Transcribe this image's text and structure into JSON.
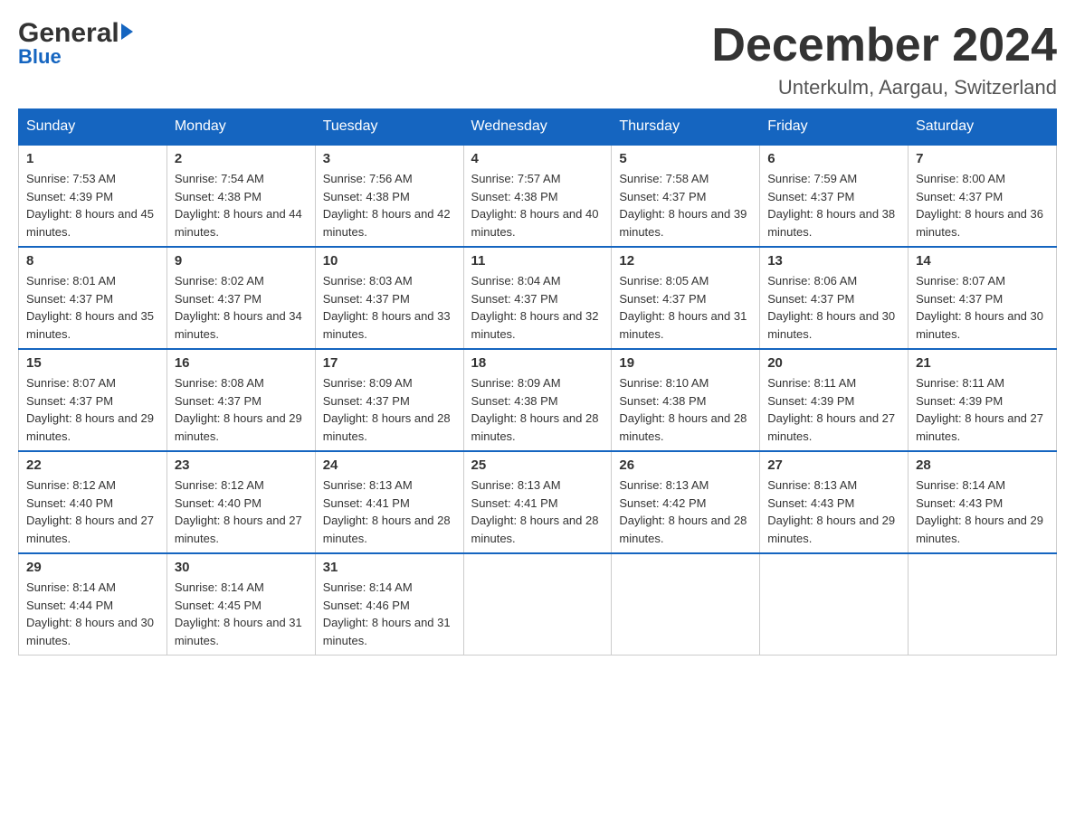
{
  "header": {
    "logo_general": "General",
    "logo_blue": "Blue",
    "month_title": "December 2024",
    "location": "Unterkulm, Aargau, Switzerland"
  },
  "weekdays": [
    "Sunday",
    "Monday",
    "Tuesday",
    "Wednesday",
    "Thursday",
    "Friday",
    "Saturday"
  ],
  "weeks": [
    [
      {
        "day": "1",
        "sunrise": "7:53 AM",
        "sunset": "4:39 PM",
        "daylight": "8 hours and 45 minutes."
      },
      {
        "day": "2",
        "sunrise": "7:54 AM",
        "sunset": "4:38 PM",
        "daylight": "8 hours and 44 minutes."
      },
      {
        "day": "3",
        "sunrise": "7:56 AM",
        "sunset": "4:38 PM",
        "daylight": "8 hours and 42 minutes."
      },
      {
        "day": "4",
        "sunrise": "7:57 AM",
        "sunset": "4:38 PM",
        "daylight": "8 hours and 40 minutes."
      },
      {
        "day": "5",
        "sunrise": "7:58 AM",
        "sunset": "4:37 PM",
        "daylight": "8 hours and 39 minutes."
      },
      {
        "day": "6",
        "sunrise": "7:59 AM",
        "sunset": "4:37 PM",
        "daylight": "8 hours and 38 minutes."
      },
      {
        "day": "7",
        "sunrise": "8:00 AM",
        "sunset": "4:37 PM",
        "daylight": "8 hours and 36 minutes."
      }
    ],
    [
      {
        "day": "8",
        "sunrise": "8:01 AM",
        "sunset": "4:37 PM",
        "daylight": "8 hours and 35 minutes."
      },
      {
        "day": "9",
        "sunrise": "8:02 AM",
        "sunset": "4:37 PM",
        "daylight": "8 hours and 34 minutes."
      },
      {
        "day": "10",
        "sunrise": "8:03 AM",
        "sunset": "4:37 PM",
        "daylight": "8 hours and 33 minutes."
      },
      {
        "day": "11",
        "sunrise": "8:04 AM",
        "sunset": "4:37 PM",
        "daylight": "8 hours and 32 minutes."
      },
      {
        "day": "12",
        "sunrise": "8:05 AM",
        "sunset": "4:37 PM",
        "daylight": "8 hours and 31 minutes."
      },
      {
        "day": "13",
        "sunrise": "8:06 AM",
        "sunset": "4:37 PM",
        "daylight": "8 hours and 30 minutes."
      },
      {
        "day": "14",
        "sunrise": "8:07 AM",
        "sunset": "4:37 PM",
        "daylight": "8 hours and 30 minutes."
      }
    ],
    [
      {
        "day": "15",
        "sunrise": "8:07 AM",
        "sunset": "4:37 PM",
        "daylight": "8 hours and 29 minutes."
      },
      {
        "day": "16",
        "sunrise": "8:08 AM",
        "sunset": "4:37 PM",
        "daylight": "8 hours and 29 minutes."
      },
      {
        "day": "17",
        "sunrise": "8:09 AM",
        "sunset": "4:37 PM",
        "daylight": "8 hours and 28 minutes."
      },
      {
        "day": "18",
        "sunrise": "8:09 AM",
        "sunset": "4:38 PM",
        "daylight": "8 hours and 28 minutes."
      },
      {
        "day": "19",
        "sunrise": "8:10 AM",
        "sunset": "4:38 PM",
        "daylight": "8 hours and 28 minutes."
      },
      {
        "day": "20",
        "sunrise": "8:11 AM",
        "sunset": "4:39 PM",
        "daylight": "8 hours and 27 minutes."
      },
      {
        "day": "21",
        "sunrise": "8:11 AM",
        "sunset": "4:39 PM",
        "daylight": "8 hours and 27 minutes."
      }
    ],
    [
      {
        "day": "22",
        "sunrise": "8:12 AM",
        "sunset": "4:40 PM",
        "daylight": "8 hours and 27 minutes."
      },
      {
        "day": "23",
        "sunrise": "8:12 AM",
        "sunset": "4:40 PM",
        "daylight": "8 hours and 27 minutes."
      },
      {
        "day": "24",
        "sunrise": "8:13 AM",
        "sunset": "4:41 PM",
        "daylight": "8 hours and 28 minutes."
      },
      {
        "day": "25",
        "sunrise": "8:13 AM",
        "sunset": "4:41 PM",
        "daylight": "8 hours and 28 minutes."
      },
      {
        "day": "26",
        "sunrise": "8:13 AM",
        "sunset": "4:42 PM",
        "daylight": "8 hours and 28 minutes."
      },
      {
        "day": "27",
        "sunrise": "8:13 AM",
        "sunset": "4:43 PM",
        "daylight": "8 hours and 29 minutes."
      },
      {
        "day": "28",
        "sunrise": "8:14 AM",
        "sunset": "4:43 PM",
        "daylight": "8 hours and 29 minutes."
      }
    ],
    [
      {
        "day": "29",
        "sunrise": "8:14 AM",
        "sunset": "4:44 PM",
        "daylight": "8 hours and 30 minutes."
      },
      {
        "day": "30",
        "sunrise": "8:14 AM",
        "sunset": "4:45 PM",
        "daylight": "8 hours and 31 minutes."
      },
      {
        "day": "31",
        "sunrise": "8:14 AM",
        "sunset": "4:46 PM",
        "daylight": "8 hours and 31 minutes."
      },
      null,
      null,
      null,
      null
    ]
  ]
}
